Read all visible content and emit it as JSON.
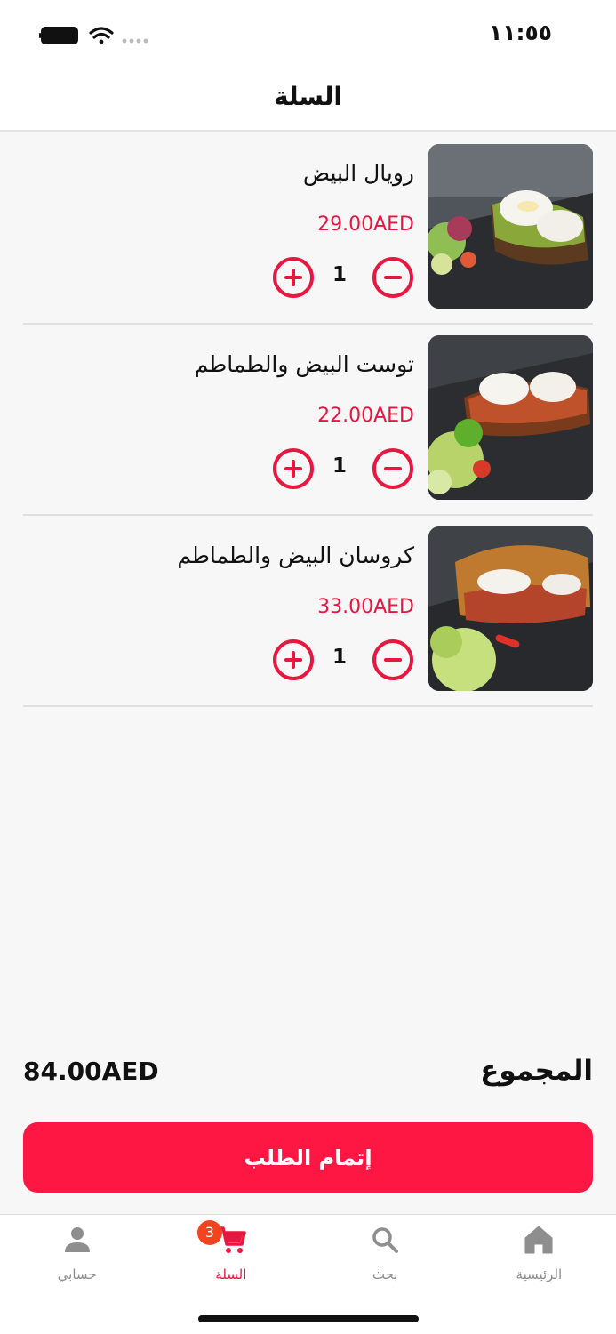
{
  "status_bar": {
    "time": "١١:٥٥"
  },
  "header": {
    "title": "السلة"
  },
  "cart": {
    "items": [
      {
        "name": "رويال البيض",
        "price": "29.00AED",
        "quantity": "1"
      },
      {
        "name": "توست البيض والطماطم",
        "price": "22.00AED",
        "quantity": "1"
      },
      {
        "name": "كروسان البيض والطماطم",
        "price": "33.00AED",
        "quantity": "1"
      }
    ]
  },
  "summary": {
    "total_label": "المجموع",
    "total_value": "84.00AED"
  },
  "checkout": {
    "label": "إتمام الطلب"
  },
  "tabs": [
    {
      "label": "الرئيسية",
      "icon": "home-icon"
    },
    {
      "label": "بحث",
      "icon": "search-icon"
    },
    {
      "label": "السلة",
      "icon": "cart-icon",
      "badge": "3"
    },
    {
      "label": "حسابي",
      "icon": "person-icon"
    }
  ],
  "colors": {
    "accent": "#e8173f",
    "button": "#ff1744",
    "badge": "#f4431e"
  }
}
